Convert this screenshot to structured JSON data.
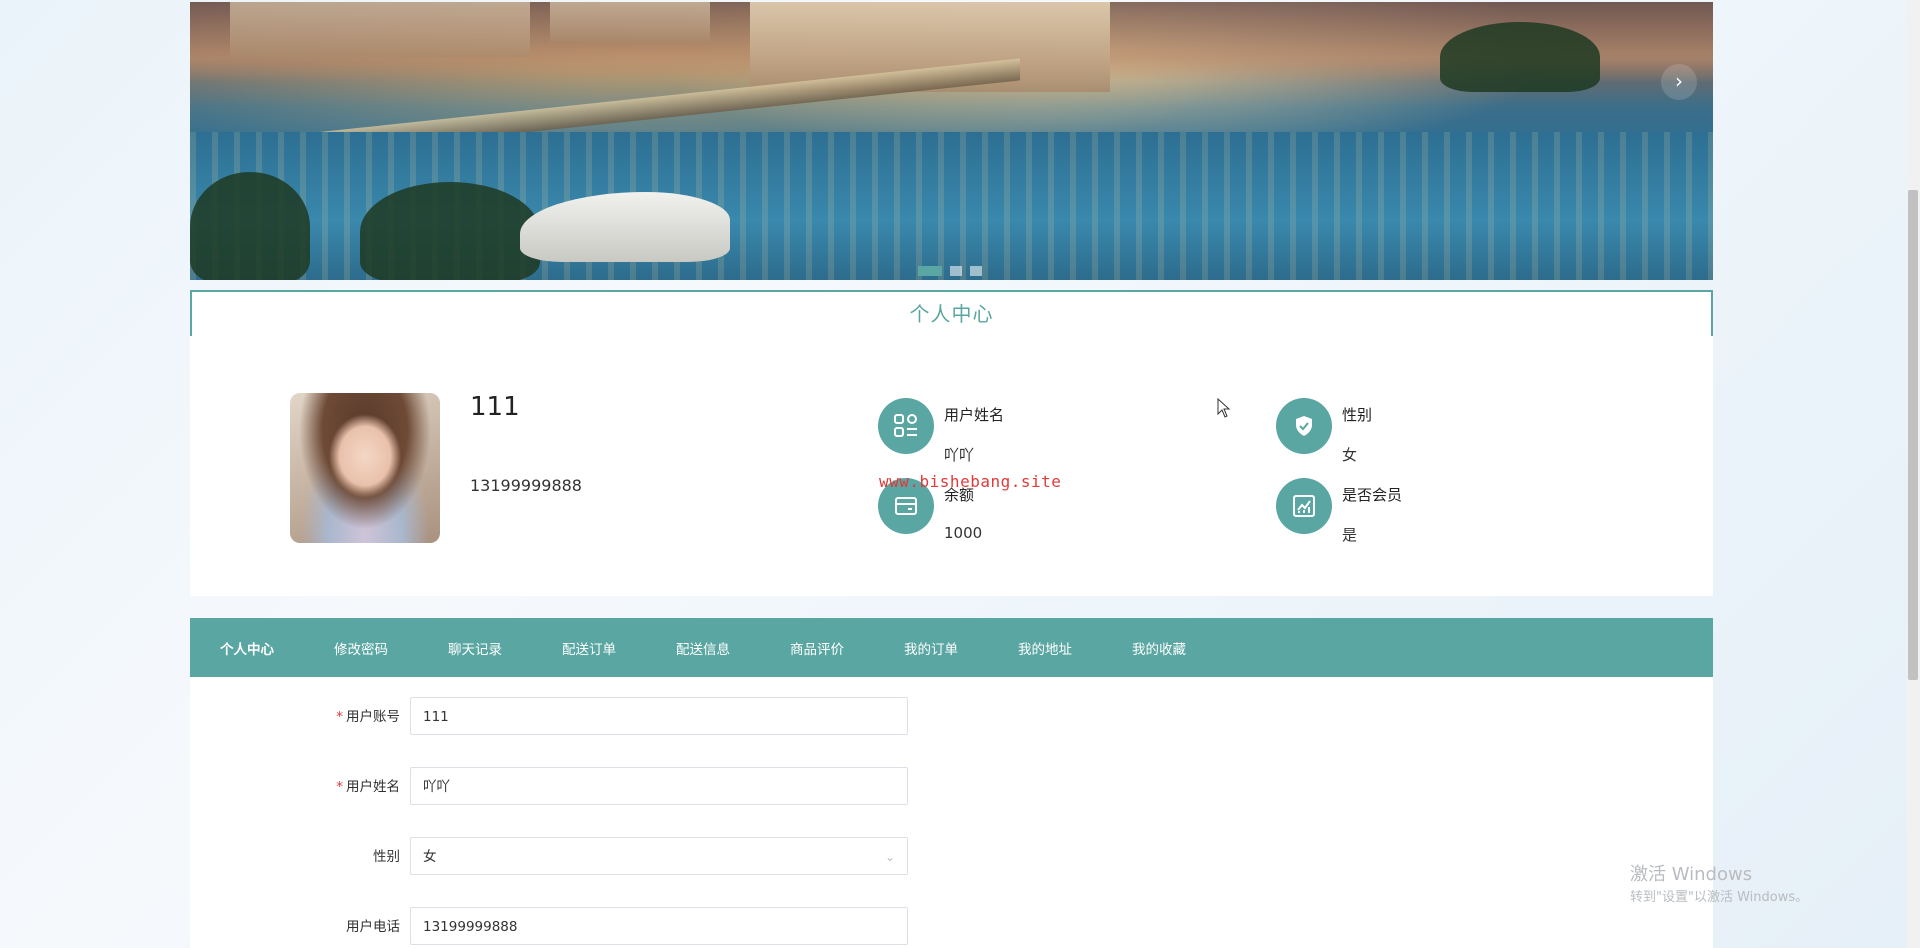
{
  "banner": {
    "next_icon": "chevron-right-icon",
    "next_glyph": "›",
    "slide_count": 3,
    "active_slide": 1
  },
  "section_title": "个人中心",
  "profile": {
    "name": "111",
    "phone": "13199999888",
    "info": [
      {
        "label": "用户姓名",
        "value": "吖吖",
        "icon": "grid-list-icon"
      },
      {
        "label": "性别",
        "value": "女",
        "icon": "shield-check-icon"
      },
      {
        "label": "余额",
        "value": "1000",
        "icon": "wallet-icon"
      },
      {
        "label": "是否会员",
        "value": "是",
        "icon": "chart-icon"
      }
    ],
    "watermark": "www.bishebang.site"
  },
  "tabs": [
    "个人中心",
    "修改密码",
    "聊天记录",
    "配送订单",
    "配送信息",
    "商品评价",
    "我的订单",
    "我的地址",
    "我的收藏"
  ],
  "active_tab": 0,
  "form": {
    "fields": [
      {
        "label": "用户账号",
        "value": "111",
        "required": true,
        "type": "text"
      },
      {
        "label": "用户姓名",
        "value": "吖吖",
        "required": true,
        "type": "text"
      },
      {
        "label": "性别",
        "value": "女",
        "required": false,
        "type": "select"
      },
      {
        "label": "用户电话",
        "value": "13199999888",
        "required": false,
        "type": "text"
      }
    ]
  },
  "windows_notice": {
    "title": "激活 Windows",
    "subtitle": "转到\"设置\"以激活 Windows。"
  },
  "colors": {
    "accent": "#5aa6a2",
    "required": "#e03a3a"
  }
}
